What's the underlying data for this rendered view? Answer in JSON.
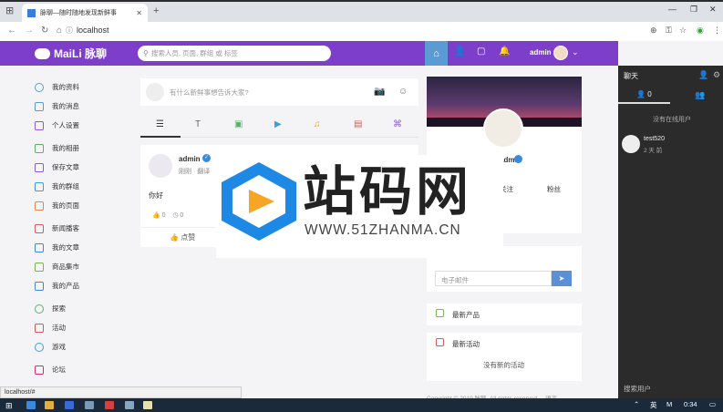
{
  "browser": {
    "tab_title": "脉聊—随时随地发现新鲜事",
    "tab_close": "✕",
    "new_tab": "+",
    "url": "localhost",
    "status_url": "localhost/#"
  },
  "appbar": {
    "brand": "MaiLi 脉聊",
    "search_placeholder": "搜索人员, 页面, 群组 或 标签",
    "user": "admin"
  },
  "sidebar": {
    "items": [
      {
        "label": "我的资料",
        "icon": "user-icon",
        "color": "#5b9bd5"
      },
      {
        "label": "我的消息",
        "icon": "message-icon",
        "color": "#5b9bd5"
      },
      {
        "label": "个人设置",
        "icon": "gear-icon",
        "color": "#8a5bd5"
      },
      {
        "label": "我的相册",
        "icon": "image-icon",
        "color": "#5bb06a"
      },
      {
        "label": "保存文章",
        "icon": "bookmark-icon",
        "color": "#8a5bd5"
      },
      {
        "label": "我的群组",
        "icon": "grid-icon",
        "color": "#3aa0d5"
      },
      {
        "label": "我的页面",
        "icon": "page-icon",
        "color": "#e08a3a"
      },
      {
        "label": "新闻播客",
        "icon": "news-icon",
        "color": "#d55b5b"
      },
      {
        "label": "我的文章",
        "icon": "book-icon",
        "color": "#3a8ad5"
      },
      {
        "label": "商品集市",
        "icon": "shop-icon",
        "color": "#7bb34a"
      },
      {
        "label": "我的产品",
        "icon": "cart-icon",
        "color": "#3a8ad5"
      },
      {
        "label": "探索",
        "icon": "search-icon",
        "color": "#5bb06a"
      },
      {
        "label": "活动",
        "icon": "calendar-icon",
        "color": "#d55b5b"
      },
      {
        "label": "游戏",
        "icon": "game-icon",
        "color": "#3aa0d5"
      },
      {
        "label": "论坛",
        "icon": "forum-icon",
        "color": "#d5306a"
      }
    ]
  },
  "composer": {
    "placeholder": "有什么新鲜事想告诉大家?"
  },
  "post": {
    "author": "admin",
    "time": "刚刚 · 翻译",
    "content": "你好",
    "likes": "0",
    "comments": "0",
    "like_label": "点赞"
  },
  "profile": {
    "name": "admin",
    "follow_label": "关注",
    "followers_label": "粉丝"
  },
  "newsletter": {
    "email_placeholder": "电子邮件"
  },
  "widgets": {
    "products_title": "最新产品",
    "events_title": "最新活动",
    "events_empty": "没有新的活动"
  },
  "footer": {
    "copyright": "Copyright © 2019 脉聊. All rights reserved.",
    "language": "语言"
  },
  "chat": {
    "title": "聊天",
    "online_count": "0",
    "empty_text": "没有在线用户",
    "contact_name": "test520",
    "contact_time": "2 天 前",
    "search_label": "搜索用户"
  },
  "taskbar": {
    "time": "0:34",
    "ime": "英",
    "ime2": "M"
  },
  "watermark": {
    "title": "站码网",
    "url": "WWW.51ZHANMA.CN"
  },
  "colors": {
    "appbar": "#7d3ec9",
    "home_active": "#5b9bd5",
    "chat_bg": "#2b2b2b",
    "send_button": "#5b8fd6"
  }
}
